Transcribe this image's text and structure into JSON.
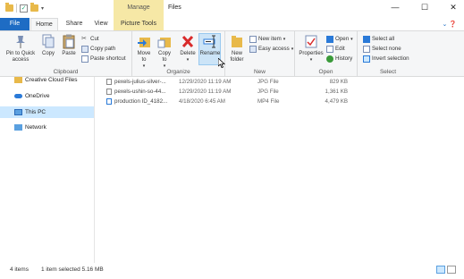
{
  "window": {
    "title": "Files",
    "contextual_tab_group": "Manage",
    "controls": {
      "minimize": "—",
      "maximize": "☐",
      "close": "✕"
    }
  },
  "tabs": [
    "File",
    "Home",
    "Share",
    "View",
    "Picture Tools"
  ],
  "ribbon": {
    "clipboard": {
      "label": "Clipboard",
      "pin": "Pin to Quick access",
      "copy": "Copy",
      "paste": "Paste",
      "cut": "Cut",
      "copy_path": "Copy path",
      "paste_shortcut": "Paste shortcut"
    },
    "organize": {
      "label": "Organize",
      "move_to": "Move to",
      "copy_to": "Copy to",
      "delete": "Delete",
      "rename": "Rename"
    },
    "new": {
      "label": "New",
      "new_folder": "New folder",
      "new_item": "New item",
      "easy_access": "Easy access"
    },
    "open": {
      "label": "Open",
      "properties": "Properties",
      "open": "Open",
      "edit": "Edit",
      "history": "History"
    },
    "select": {
      "label": "Select",
      "select_all": "Select all",
      "select_none": "Select none",
      "invert": "Invert selection"
    }
  },
  "nav": [
    {
      "label": "Creative Cloud Files",
      "icon": "creative-cloud-icon",
      "selected": false
    },
    {
      "label": "OneDrive",
      "icon": "onedrive-icon",
      "selected": false
    },
    {
      "label": "This PC",
      "icon": "computer-icon",
      "selected": true
    },
    {
      "label": "Network",
      "icon": "network-icon",
      "selected": false
    }
  ],
  "files": [
    {
      "name": "pexels-julius-silver-...",
      "date": "12/29/2020 11:19 AM",
      "type": "JPG File",
      "size": "829 KB"
    },
    {
      "name": "pexels-ushin-so-44...",
      "date": "12/29/2020 11:19 AM",
      "type": "JPG File",
      "size": "1,361 KB"
    },
    {
      "name": "production ID_4182...",
      "date": "4/18/2020 6:45 AM",
      "type": "MP4 File",
      "size": "4,479 KB"
    }
  ],
  "status": {
    "count": "4 items",
    "selection": "1 item selected  5.16 MB"
  },
  "colors": {
    "accent": "#1e6cc4",
    "contextual_tab": "#f6e8a6",
    "selection": "#cce8ff"
  }
}
